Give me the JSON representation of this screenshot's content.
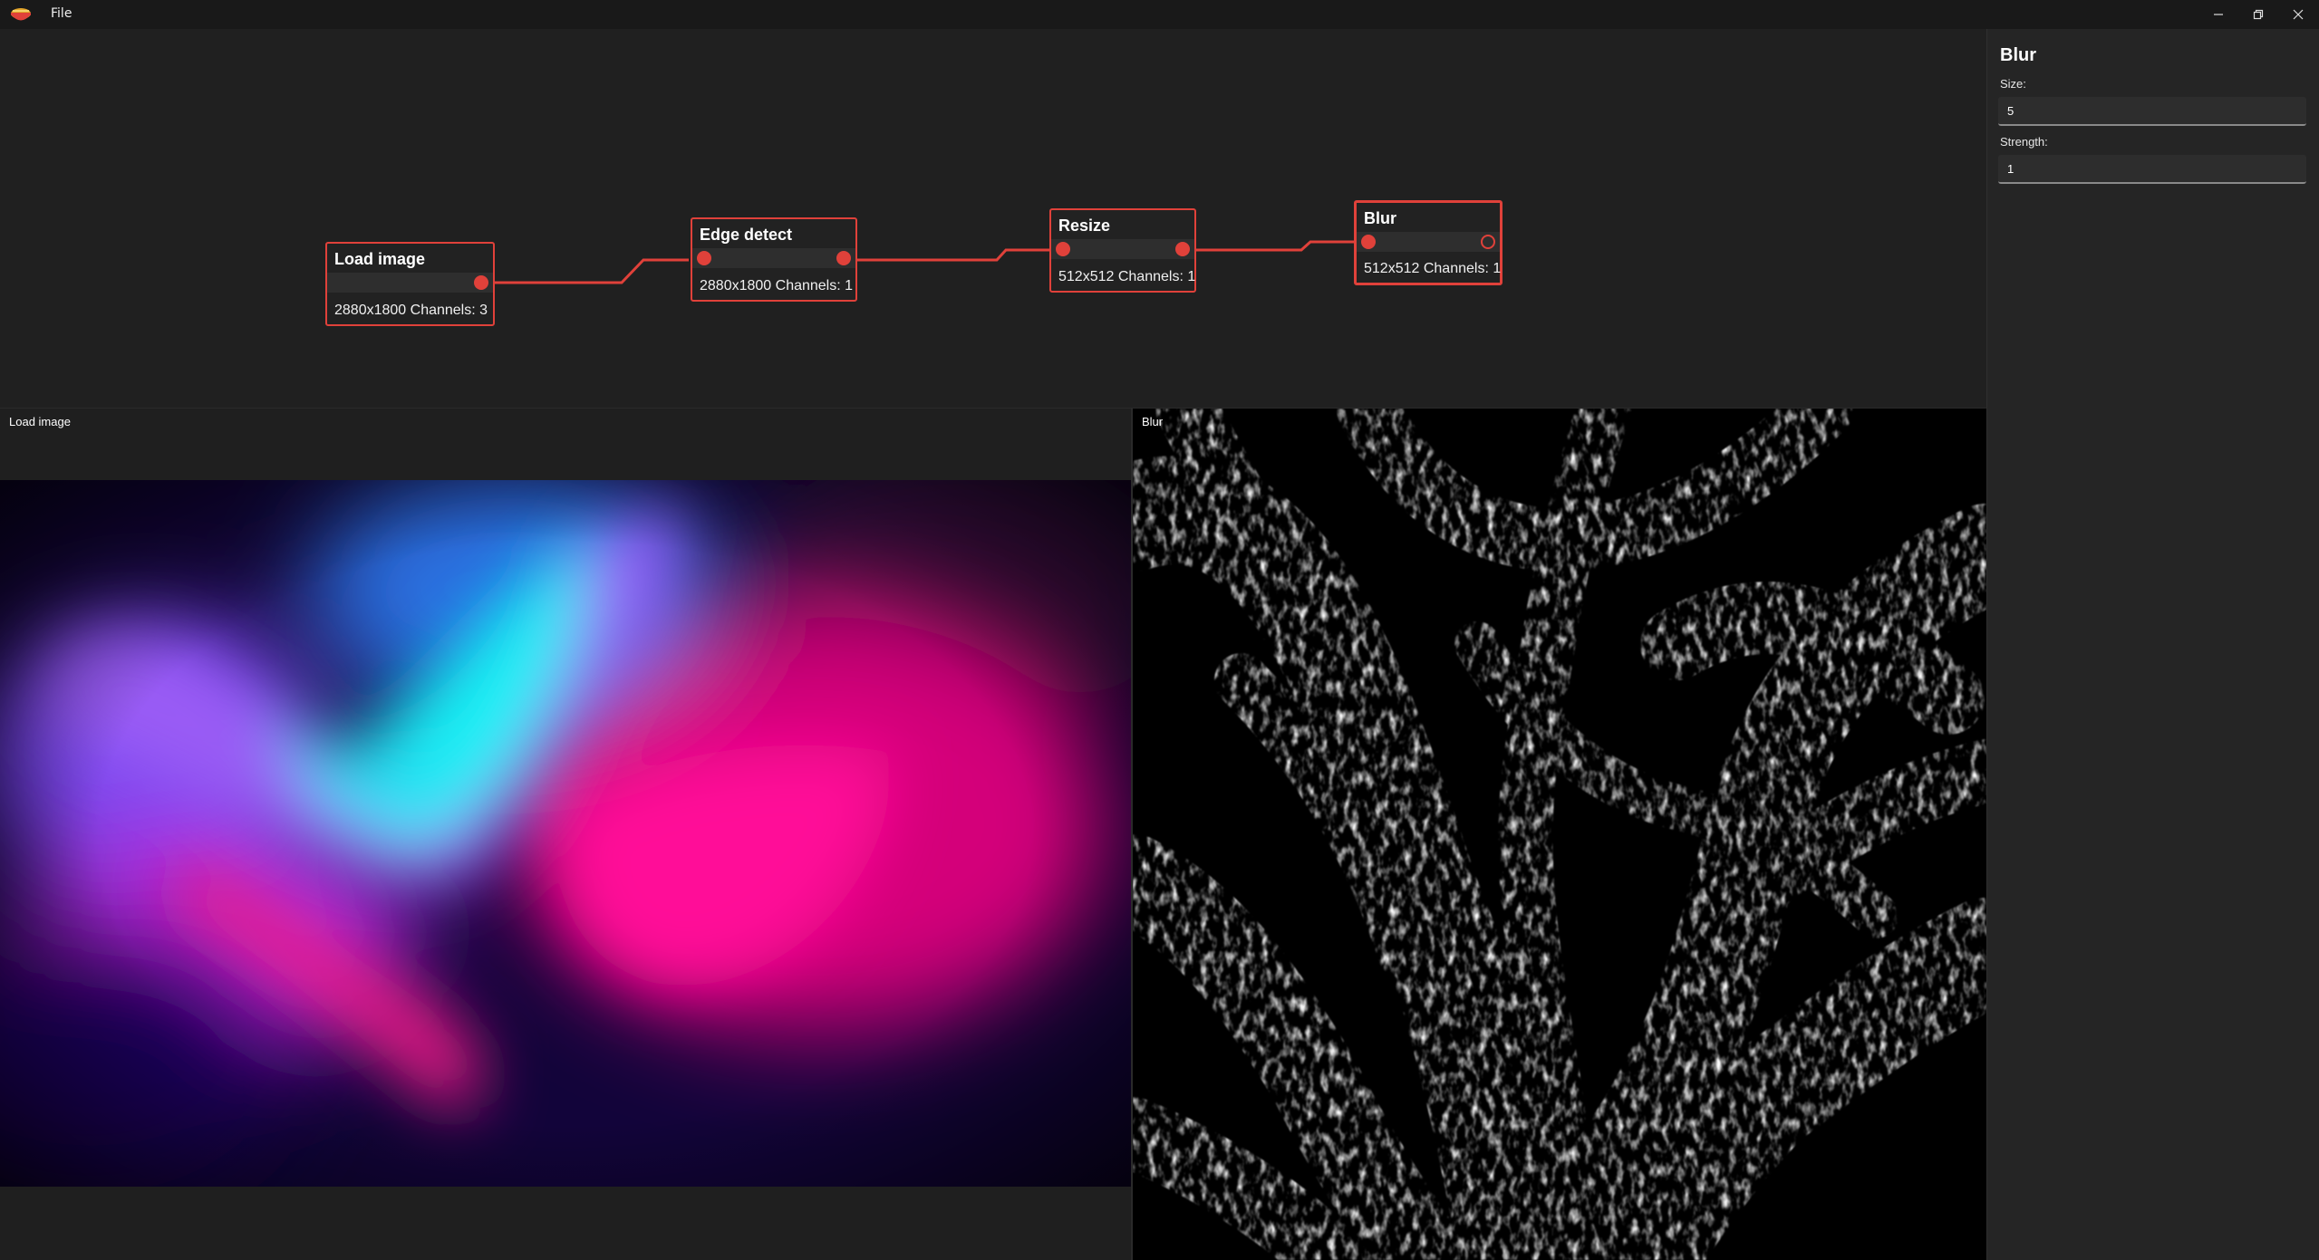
{
  "app": {
    "menu": [
      "File"
    ],
    "icon": "app-logo-icon"
  },
  "window_controls": {
    "minimize_icon": "minimize-icon",
    "maximize_icon": "restore-icon",
    "close_icon": "close-icon"
  },
  "graph": {
    "accent_color": "#e0413a",
    "nodes": [
      {
        "title": "Load image",
        "info": "2880x1800 Channels: 3"
      },
      {
        "title": "Edge detect",
        "info": "2880x1800 Channels: 1"
      },
      {
        "title": "Resize",
        "info": "512x512 Channels: 1"
      },
      {
        "title": "Blur",
        "info": "512x512 Channels: 1"
      }
    ]
  },
  "previews": {
    "left_label": "Load image",
    "right_label": "Blur"
  },
  "properties": {
    "title": "Blur",
    "size_label": "Size:",
    "size_value": "5",
    "strength_label": "Strength:",
    "strength_value": "1"
  }
}
